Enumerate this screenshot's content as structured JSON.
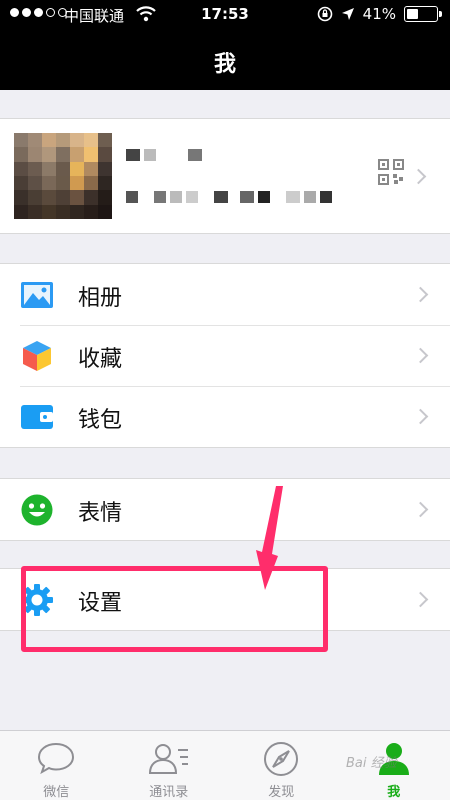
{
  "status_bar": {
    "carrier": "中国联通",
    "time": "17:53",
    "battery": "41%",
    "battery_level": 0.41
  },
  "nav": {
    "title": "我"
  },
  "menu": [
    {
      "label": "相册",
      "icon": "photo-album-icon"
    },
    {
      "label": "收藏",
      "icon": "favorites-cube-icon"
    },
    {
      "label": "钱包",
      "icon": "wallet-icon"
    },
    {
      "label": "表情",
      "icon": "emoji-smile-icon"
    },
    {
      "label": "设置",
      "icon": "settings-gear-icon"
    }
  ],
  "tabs": [
    {
      "label": "微信",
      "icon": "chat-bubble-icon",
      "active": false
    },
    {
      "label": "通讯录",
      "icon": "contacts-icon",
      "active": false
    },
    {
      "label": "发现",
      "icon": "compass-icon",
      "active": false
    },
    {
      "label": "我",
      "icon": "me-person-icon",
      "active": true
    }
  ],
  "colors": {
    "accent_green": "#1aad19",
    "annotation": "#ff2d6b",
    "nav_bg": "#000000",
    "page_bg": "#efeff4"
  }
}
